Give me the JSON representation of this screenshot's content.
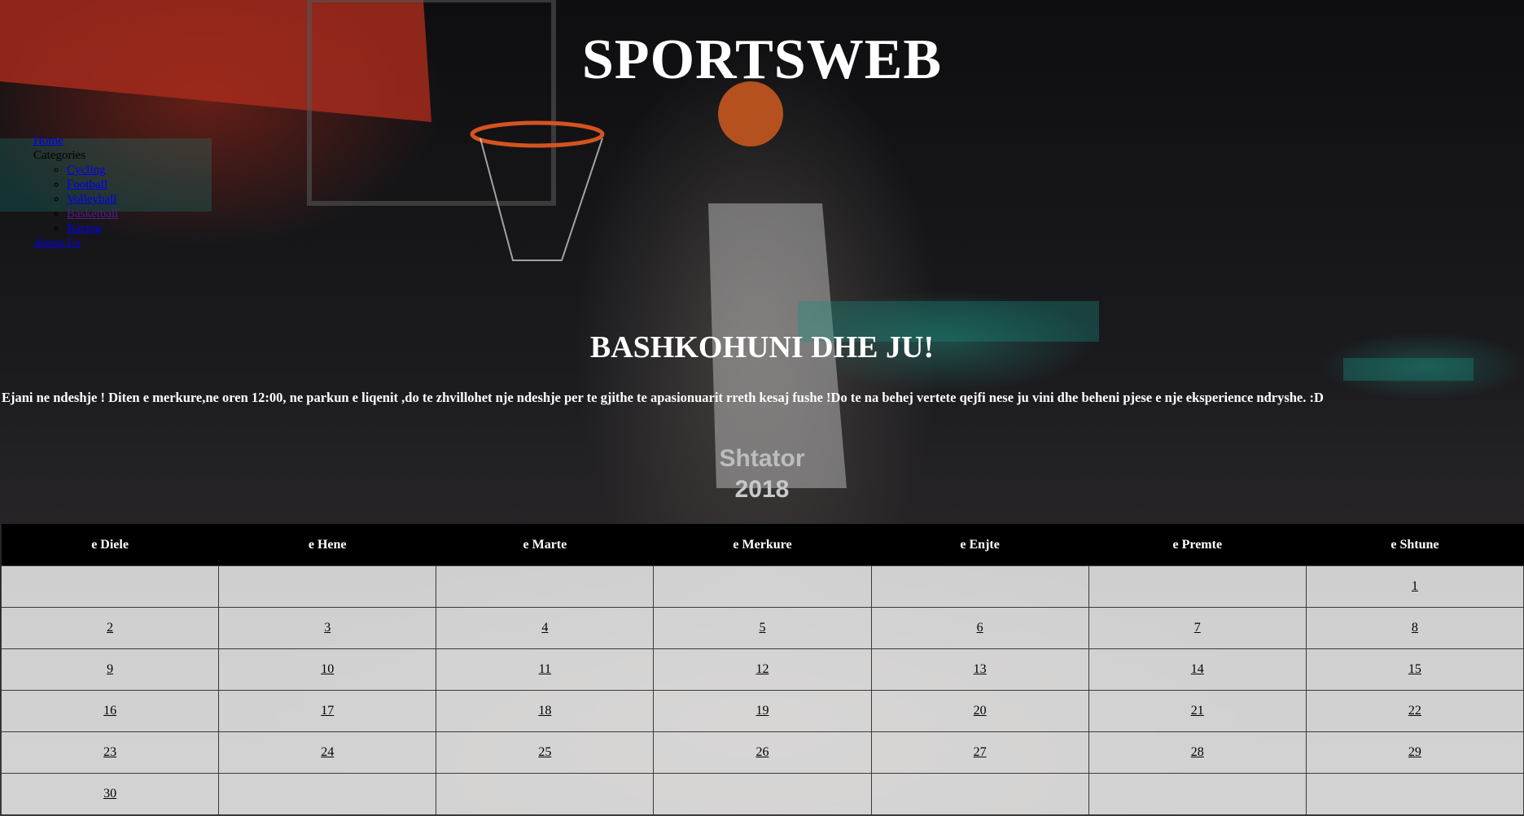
{
  "header": {
    "title": "SPORTSWEB"
  },
  "nav": {
    "home": "Home",
    "categories_label": "Categories",
    "categories": [
      "Cycling",
      "Football",
      "Volleyball",
      "Basketball",
      "Racing"
    ],
    "about": "About Us"
  },
  "main": {
    "heading": "BASHKOHUNI DHE JU!",
    "intro": "Ejani ne ndeshje ! Diten e merkure,ne oren 12:00, ne parkun e liqenit ,do te zhvillohet nje ndeshje per te gjithe te apasionuarit rreth kesaj fushe !Do te na behej vertete qejfi nese ju vini dhe beheni pjese e nje eksperience ndryshe. :D"
  },
  "calendar": {
    "month": "Shtator",
    "year": "2018",
    "weekdays": [
      "e Diele",
      "e Hene",
      "e Marte",
      "e Merkure",
      "e Enjte",
      "e Premte",
      "e Shtune"
    ],
    "weeks": [
      [
        "",
        "",
        "",
        "",
        "",
        "",
        "1"
      ],
      [
        "2",
        "3",
        "4",
        "5",
        "6",
        "7",
        "8"
      ],
      [
        "9",
        "10",
        "11",
        "12",
        "13",
        "14",
        "15"
      ],
      [
        "16",
        "17",
        "18",
        "19",
        "20",
        "21",
        "22"
      ],
      [
        "23",
        "24",
        "25",
        "26",
        "27",
        "28",
        "29"
      ],
      [
        "30",
        "",
        "",
        "",
        "",
        "",
        ""
      ]
    ]
  }
}
